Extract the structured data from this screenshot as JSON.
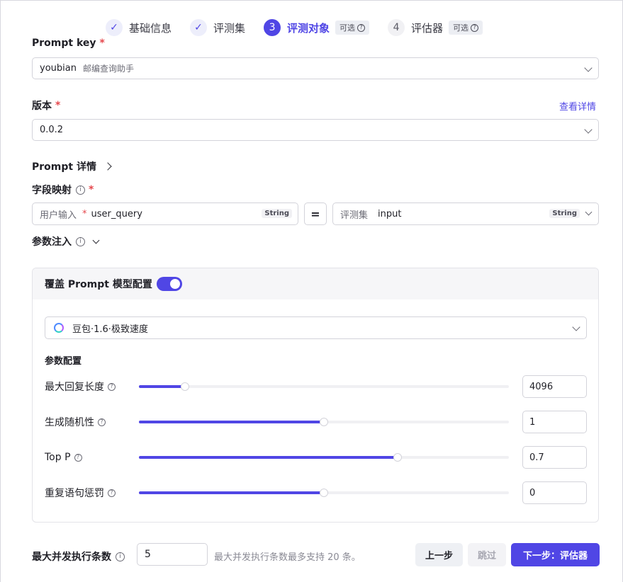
{
  "stepper": {
    "steps": [
      {
        "label": "基础信息",
        "state": "done",
        "marker": "✓"
      },
      {
        "label": "评测集",
        "state": "done",
        "marker": "✓"
      },
      {
        "label": "评测对象",
        "state": "active",
        "marker": "3",
        "badge": "可选"
      },
      {
        "label": "评估器",
        "state": "todo",
        "marker": "4",
        "badge": "可选"
      }
    ]
  },
  "prompt_key": {
    "label": "Prompt key",
    "required_mark": "*",
    "value": "youbian",
    "value_desc": "邮编查询助手"
  },
  "version": {
    "label": "版本",
    "required_mark": "*",
    "value": "0.0.2",
    "detail_link": "查看详情"
  },
  "prompt_detail": {
    "label": "Prompt 详情"
  },
  "field_mapping": {
    "label": "字段映射",
    "required_mark": "*",
    "left": {
      "prefix": "用户输入",
      "required_mark": "*",
      "name": "user_query",
      "type": "String"
    },
    "operator": "=",
    "right": {
      "prefix": "评测集",
      "name": "input",
      "type": "String"
    }
  },
  "param_injection": {
    "label": "参数注入"
  },
  "model_override": {
    "label": "覆盖 Prompt 模型配置",
    "enabled": true,
    "model": "豆包·1.6·极致速度",
    "params_title": "参数配置",
    "params": [
      {
        "label": "最大回复长度",
        "value": "4096",
        "level": 0.125
      },
      {
        "label": "生成随机性",
        "value": "1",
        "level": 0.5
      },
      {
        "label": "Top P",
        "value": "0.7",
        "level": 0.7
      },
      {
        "label": "重复语句惩罚",
        "value": "0",
        "level": 0.5
      }
    ]
  },
  "footer": {
    "concurrency_label": "最大并发执行条数",
    "concurrency_value": "5",
    "concurrency_hint": "最大并发执行条数最多支持 20 条。",
    "prev_button": "上一步",
    "skip_button": "跳过",
    "next_button": "下一步：评估器"
  },
  "colors": {
    "accent": "#5046e5",
    "required": "#e5484d"
  }
}
